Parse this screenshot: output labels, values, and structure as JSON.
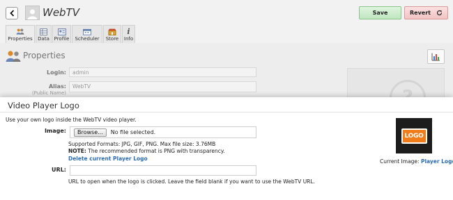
{
  "header": {
    "title": "WebTV",
    "save_label": "Save",
    "revert_label": "Revert"
  },
  "tabs": [
    {
      "label": "Properties",
      "icon": "users-icon",
      "active": true
    },
    {
      "label": "Data",
      "icon": "grid-icon",
      "active": false
    },
    {
      "label": "Profile",
      "icon": "profile-card-icon",
      "active": false
    },
    {
      "label": "Scheduler",
      "icon": "scheduler-icon",
      "active": false
    },
    {
      "label": "Store",
      "icon": "store-icon",
      "active": false
    },
    {
      "label": "Info",
      "icon": "info-icon",
      "active": false
    }
  ],
  "properties": {
    "title": "Properties",
    "login_label": "Login:",
    "login_value": "admin",
    "alias_label": "Alias:",
    "alias_sub": "(Public Name)",
    "alias_value": "WebTV"
  },
  "dialog": {
    "title": "Video Player Logo",
    "description": "Use your own logo inside the WebTV video player.",
    "image_label": "Image:",
    "browse_label": "Browse...",
    "file_status": "No file selected.",
    "formats_text": "Supported Formats: JPG, GIF, PNG. Max file size: 3.76MB",
    "note_label": "NOTE:",
    "note_text": "The recommended format is PNG with transparency.",
    "delete_link": "Delete current Player Logo",
    "url_label": "URL:",
    "url_value": "",
    "url_hint": "URL to open when the logo is clicked. Leave the field blank if you want to use the WebTV URL.",
    "logo_text": "LOGO",
    "current_image_label": "Current Image:",
    "current_image_link": "Player Logo"
  },
  "colors": {
    "link": "#2c6cb3",
    "save_bg": "#cdeccd",
    "revert_bg": "#f6d0d0",
    "logo_orange": "#f07d1a"
  }
}
